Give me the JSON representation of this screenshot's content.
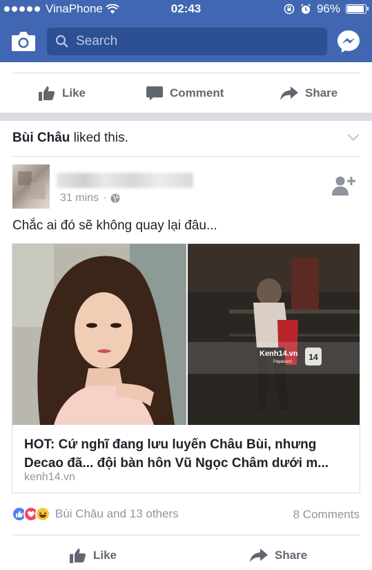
{
  "status_bar": {
    "carrier": "VinaPhone",
    "time": "02:43",
    "battery": "96%",
    "battery_level": 0.96
  },
  "nav": {
    "search_placeholder": "Search",
    "bg_color": "#4267b2",
    "search_bg_color": "#2d4f94"
  },
  "top_actions": {
    "like": "Like",
    "comment": "Comment",
    "share": "Share"
  },
  "story": {
    "liker": "Bùi Châu",
    "liked_suffix": " liked this.",
    "post_time": "31 mins",
    "post_text": "Chắc ai đó sẽ không quay lại đâu...",
    "link": {
      "title": "HOT: Cứ nghĩ đang lưu luyến Châu Bùi, nhưng Decao đã... đội bàn hôn Vũ Ngọc Châm dưới m...",
      "source": "kenh14.vn",
      "watermark": "Kenh14.vn",
      "watermark_sub": "Paparazzi",
      "badge": "14"
    },
    "reactions": {
      "icons": [
        "like-reaction-icon",
        "love-reaction-icon",
        "haha-reaction-icon"
      ],
      "summary": "Bùi Châu and 13 others",
      "comments": "8 Comments"
    },
    "bottom_actions": {
      "like": "Like",
      "share": "Share"
    }
  }
}
